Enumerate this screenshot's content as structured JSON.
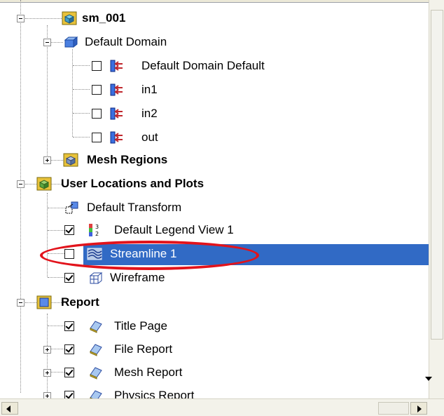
{
  "tree": {
    "root": {
      "label": "sm_001"
    },
    "domain": {
      "label": "Default Domain"
    },
    "boundaries": [
      {
        "label": "Default Domain Default",
        "checked": false
      },
      {
        "label": "in1",
        "checked": false
      },
      {
        "label": "in2",
        "checked": false
      },
      {
        "label": "out",
        "checked": false
      }
    ],
    "mesh_regions": {
      "label": "Mesh Regions"
    },
    "user_locations": {
      "label": "User Locations and Plots"
    },
    "user_items": [
      {
        "label": "Default Transform",
        "checked": null
      },
      {
        "label": "Default Legend View 1",
        "checked": true
      },
      {
        "label": "Streamline 1",
        "checked": false,
        "selected": true
      },
      {
        "label": "Wireframe",
        "checked": true
      }
    ],
    "report": {
      "label": "Report"
    },
    "report_items": [
      {
        "label": "Title Page",
        "checked": true
      },
      {
        "label": "File Report",
        "checked": true
      },
      {
        "label": "Mesh Report",
        "checked": true
      },
      {
        "label": "Physics Report",
        "checked": true
      }
    ]
  },
  "colors": {
    "selection": "#316ac5",
    "highlight_oval": "#e2131b"
  }
}
